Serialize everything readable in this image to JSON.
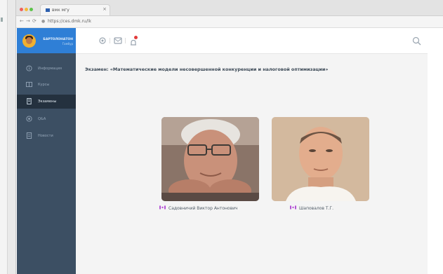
{
  "browser": {
    "tab_title": "вмк мгу",
    "tab_close": "×",
    "url": "https://ces.dmk.ru/lk",
    "nav_back": "←",
    "nav_forward": "→",
    "nav_reload": "⟳"
  },
  "sidebar": {
    "profile": {
      "name": "БАРТОЛОНАТОН",
      "subtitle": "Гамбур"
    },
    "items": [
      {
        "label": "Информация",
        "icon": "info-icon",
        "active": false
      },
      {
        "label": "Курсы",
        "icon": "book-icon",
        "active": false
      },
      {
        "label": "Экзамены",
        "icon": "exam-icon",
        "active": true
      },
      {
        "label": "Q&A",
        "icon": "chat-icon",
        "active": false
      },
      {
        "label": "Новости",
        "icon": "news-icon",
        "active": false
      }
    ]
  },
  "topbar": {
    "icons": [
      "settings-icon",
      "messages-icon",
      "notifications-icon",
      "search-icon"
    ],
    "notification_badge": true
  },
  "main": {
    "exam_title": "Экзамен: «Математические модели несовершенной конкуренции и налоговой оптимизации»",
    "teachers": [
      {
        "name": "Садовничий Виктор Антонович",
        "photo": "teacher-photo-older-man"
      },
      {
        "name": "Шаповалов Т.Г.",
        "photo": "teacher-photo-young-man"
      }
    ]
  },
  "colors": {
    "sidebar_bg": "#3c4f63",
    "profile_bg": "#2f7fd6",
    "active_item_bg": "#24313f",
    "teacher_icon": "#b454d6",
    "notification": "#e23b3b"
  }
}
